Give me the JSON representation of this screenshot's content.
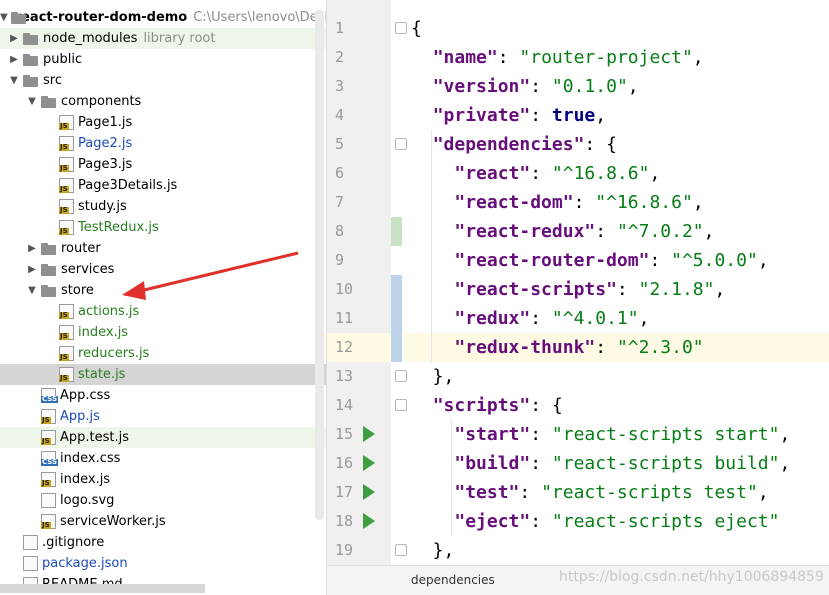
{
  "project": {
    "root_name": "react-router-dom-demo",
    "root_path": "C:\\Users\\lenovo\\Desktop",
    "library_root_label": "library root"
  },
  "tree": [
    {
      "label": "node_modules",
      "kind": "folder",
      "depth": 1,
      "arrow": "▶",
      "extra": "library root",
      "style": "hl-green"
    },
    {
      "label": "public",
      "kind": "folder",
      "depth": 1,
      "arrow": "▶"
    },
    {
      "label": "src",
      "kind": "folder",
      "depth": 1,
      "arrow": "▼"
    },
    {
      "label": "components",
      "kind": "folder",
      "depth": 2,
      "arrow": "▼"
    },
    {
      "label": "Page1.js",
      "kind": "js",
      "depth": 3
    },
    {
      "label": "Page2.js",
      "kind": "js",
      "depth": 3,
      "color": "t-blue"
    },
    {
      "label": "Page3.js",
      "kind": "js",
      "depth": 3
    },
    {
      "label": "Page3Details.js",
      "kind": "js",
      "depth": 3
    },
    {
      "label": "study.js",
      "kind": "js",
      "depth": 3
    },
    {
      "label": "TestRedux.js",
      "kind": "js",
      "depth": 3,
      "color": "t-green"
    },
    {
      "label": "router",
      "kind": "folder",
      "depth": 2,
      "arrow": "▶"
    },
    {
      "label": "services",
      "kind": "folder",
      "depth": 2,
      "arrow": "▶"
    },
    {
      "label": "store",
      "kind": "folder",
      "depth": 2,
      "arrow": "▼"
    },
    {
      "label": "actions.js",
      "kind": "js",
      "depth": 3,
      "color": "t-green"
    },
    {
      "label": "index.js",
      "kind": "js",
      "depth": 3,
      "color": "t-green"
    },
    {
      "label": "reducers.js",
      "kind": "js",
      "depth": 3,
      "color": "t-green"
    },
    {
      "label": "state.js",
      "kind": "js",
      "depth": 3,
      "color": "t-green",
      "style": "hl-gray"
    },
    {
      "label": "App.css",
      "kind": "css",
      "depth": 2
    },
    {
      "label": "App.js",
      "kind": "js",
      "depth": 2,
      "color": "t-blue"
    },
    {
      "label": "App.test.js",
      "kind": "js",
      "depth": 2,
      "style": "hl-green"
    },
    {
      "label": "index.css",
      "kind": "css",
      "depth": 2
    },
    {
      "label": "index.js",
      "kind": "js",
      "depth": 2
    },
    {
      "label": "logo.svg",
      "kind": "svg",
      "depth": 2
    },
    {
      "label": "serviceWorker.js",
      "kind": "js",
      "depth": 2
    },
    {
      "label": ".gitignore",
      "kind": "git",
      "depth": 1
    },
    {
      "label": "package.json",
      "kind": "json",
      "depth": 1,
      "color": "t-blue"
    },
    {
      "label": "README.md",
      "kind": "md",
      "depth": 1
    }
  ],
  "editor": {
    "line_numbers": [
      "1",
      "2",
      "3",
      "4",
      "5",
      "6",
      "7",
      "8",
      "9",
      "10",
      "11",
      "12",
      "13",
      "14",
      "15",
      "16",
      "17",
      "18",
      "19"
    ],
    "lines": [
      [
        [
          "p",
          "{"
        ]
      ],
      [
        [
          "p",
          "  "
        ],
        [
          "k",
          "\"name\""
        ],
        [
          "p",
          ": "
        ],
        [
          "s",
          "\"router-project\""
        ],
        [
          "p",
          ","
        ]
      ],
      [
        [
          "p",
          "  "
        ],
        [
          "k",
          "\"version\""
        ],
        [
          "p",
          ": "
        ],
        [
          "s",
          "\"0.1.0\""
        ],
        [
          "p",
          ","
        ]
      ],
      [
        [
          "p",
          "  "
        ],
        [
          "k",
          "\"private\""
        ],
        [
          "p",
          ": "
        ],
        [
          "b",
          "true"
        ],
        [
          "p",
          ","
        ]
      ],
      [
        [
          "p",
          "  "
        ],
        [
          "k",
          "\"dependencies\""
        ],
        [
          "p",
          ": {"
        ]
      ],
      [
        [
          "p",
          "    "
        ],
        [
          "k",
          "\"react\""
        ],
        [
          "p",
          ": "
        ],
        [
          "s",
          "\"^16.8.6\""
        ],
        [
          "p",
          ","
        ]
      ],
      [
        [
          "p",
          "    "
        ],
        [
          "k",
          "\"react-dom\""
        ],
        [
          "p",
          ": "
        ],
        [
          "s",
          "\"^16.8.6\""
        ],
        [
          "p",
          ","
        ]
      ],
      [
        [
          "p",
          "    "
        ],
        [
          "k",
          "\"react-redux\""
        ],
        [
          "p",
          ": "
        ],
        [
          "s",
          "\"^7.0.2\""
        ],
        [
          "p",
          ","
        ]
      ],
      [
        [
          "p",
          "    "
        ],
        [
          "k",
          "\"react-router-dom\""
        ],
        [
          "p",
          ": "
        ],
        [
          "s",
          "\"^5.0.0\""
        ],
        [
          "p",
          ","
        ]
      ],
      [
        [
          "p",
          "    "
        ],
        [
          "k",
          "\"react-scripts\""
        ],
        [
          "p",
          ": "
        ],
        [
          "s",
          "\"2.1.8\""
        ],
        [
          "p",
          ","
        ]
      ],
      [
        [
          "p",
          "    "
        ],
        [
          "k",
          "\"redux\""
        ],
        [
          "p",
          ": "
        ],
        [
          "s",
          "\"^4.0.1\""
        ],
        [
          "p",
          ","
        ]
      ],
      [
        [
          "p",
          "    "
        ],
        [
          "k",
          "\"redux-thunk\""
        ],
        [
          "p",
          ": "
        ],
        [
          "s",
          "\"^2.3.0\""
        ]
      ],
      [
        [
          "p",
          "  },"
        ]
      ],
      [
        [
          "p",
          "  "
        ],
        [
          "k",
          "\"scripts\""
        ],
        [
          "p",
          ": {"
        ]
      ],
      [
        [
          "p",
          "    "
        ],
        [
          "k",
          "\"start\""
        ],
        [
          "p",
          ": "
        ],
        [
          "s",
          "\"react-scripts start\""
        ],
        [
          "p",
          ","
        ]
      ],
      [
        [
          "p",
          "    "
        ],
        [
          "k",
          "\"build\""
        ],
        [
          "p",
          ": "
        ],
        [
          "s",
          "\"react-scripts build\""
        ],
        [
          "p",
          ","
        ]
      ],
      [
        [
          "p",
          "    "
        ],
        [
          "k",
          "\"test\""
        ],
        [
          "p",
          ": "
        ],
        [
          "s",
          "\"react-scripts test\""
        ],
        [
          "p",
          ","
        ]
      ],
      [
        [
          "p",
          "    "
        ],
        [
          "k",
          "\"eject\""
        ],
        [
          "p",
          ": "
        ],
        [
          "s",
          "\"react-scripts eject\""
        ]
      ],
      [
        [
          "p",
          "  },"
        ]
      ]
    ],
    "current_line": 12,
    "run_lines": [
      15,
      16,
      17,
      18
    ],
    "fold_lines": [
      1,
      5,
      13,
      14,
      19
    ],
    "colors": {
      "added": "#c9e2c4",
      "modified": "#bcd3ea",
      "run": "#3d9d41",
      "annotation_arrow": "#e0312b"
    }
  },
  "status": {
    "breadcrumb": "dependencies",
    "watermark": "https://blog.csdn.net/hhy1006894859"
  }
}
